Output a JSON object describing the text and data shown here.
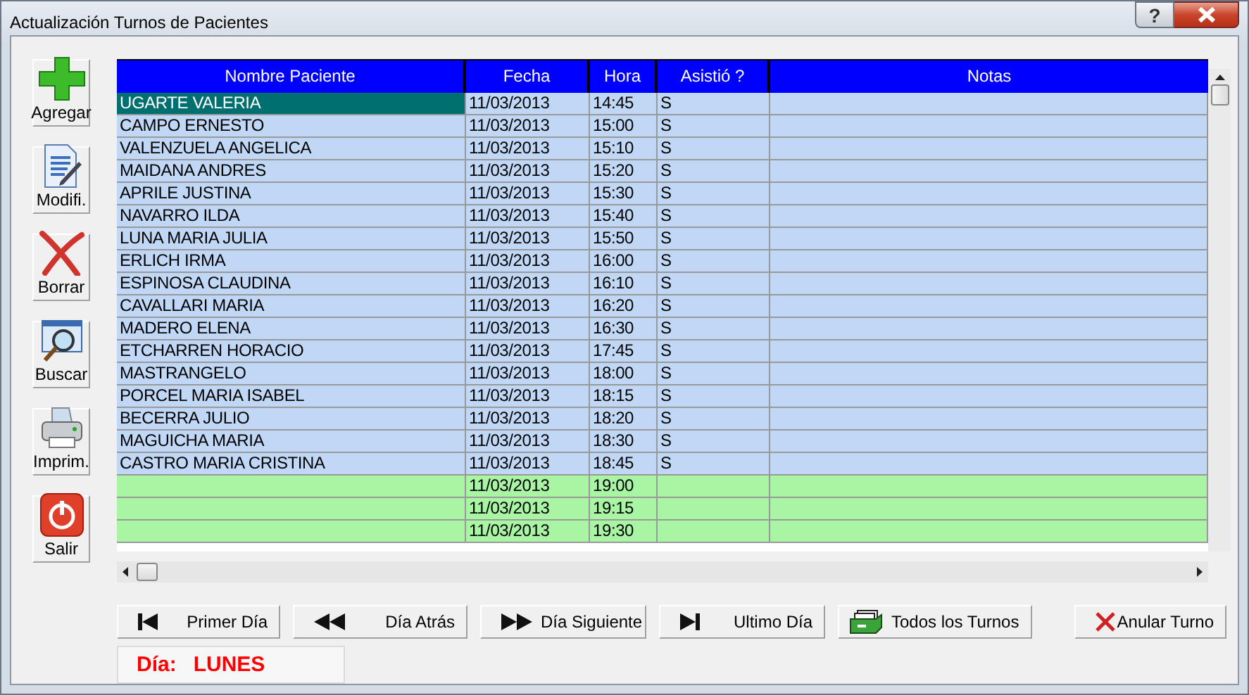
{
  "window": {
    "title": "Actualización Turnos de Pacientes",
    "help": "?"
  },
  "toolbar": [
    {
      "label": "Agregar"
    },
    {
      "label": "Modifi."
    },
    {
      "label": "Borrar"
    },
    {
      "label": "Buscar"
    },
    {
      "label": "Imprim."
    },
    {
      "label": "Salir"
    }
  ],
  "table": {
    "columns": [
      "Nombre Paciente",
      "Fecha",
      "Hora",
      "Asistió ?",
      "Notas"
    ],
    "rows": [
      {
        "kind": "booked",
        "selected": true,
        "name": "UGARTE VALERIA",
        "date": "11/03/2013",
        "time": "14:45",
        "attended": "S"
      },
      {
        "kind": "booked",
        "selected": false,
        "name": "CAMPO ERNESTO",
        "date": "11/03/2013",
        "time": "15:00",
        "attended": "S"
      },
      {
        "kind": "booked",
        "selected": false,
        "name": "VALENZUELA ANGELICA",
        "date": "11/03/2013",
        "time": "15:10",
        "attended": "S"
      },
      {
        "kind": "booked",
        "selected": false,
        "name": "MAIDANA ANDRES",
        "date": "11/03/2013",
        "time": "15:20",
        "attended": "S"
      },
      {
        "kind": "booked",
        "selected": false,
        "name": "APRILE JUSTINA",
        "date": "11/03/2013",
        "time": "15:30",
        "attended": "S"
      },
      {
        "kind": "booked",
        "selected": false,
        "name": "NAVARRO ILDA",
        "date": "11/03/2013",
        "time": "15:40",
        "attended": "S"
      },
      {
        "kind": "booked",
        "selected": false,
        "name": "LUNA MARIA JULIA",
        "date": "11/03/2013",
        "time": "15:50",
        "attended": "S"
      },
      {
        "kind": "booked",
        "selected": false,
        "name": "ERLICH IRMA",
        "date": "11/03/2013",
        "time": "16:00",
        "attended": "S"
      },
      {
        "kind": "booked",
        "selected": false,
        "name": "ESPINOSA CLAUDINA",
        "date": "11/03/2013",
        "time": "16:10",
        "attended": "S"
      },
      {
        "kind": "booked",
        "selected": false,
        "name": "CAVALLARI MARIA",
        "date": "11/03/2013",
        "time": "16:20",
        "attended": "S"
      },
      {
        "kind": "booked",
        "selected": false,
        "name": "MADERO ELENA",
        "date": "11/03/2013",
        "time": "16:30",
        "attended": "S"
      },
      {
        "kind": "booked",
        "selected": false,
        "name": "ETCHARREN HORACIO",
        "date": "11/03/2013",
        "time": "17:45",
        "attended": "S"
      },
      {
        "kind": "booked",
        "selected": false,
        "name": "MASTRANGELO",
        "date": "11/03/2013",
        "time": "18:00",
        "attended": "S"
      },
      {
        "kind": "booked",
        "selected": false,
        "name": "PORCEL MARIA ISABEL",
        "date": "11/03/2013",
        "time": "18:15",
        "attended": "S"
      },
      {
        "kind": "booked",
        "selected": false,
        "name": "BECERRA JULIO",
        "date": "11/03/2013",
        "time": "18:20",
        "attended": "S"
      },
      {
        "kind": "booked",
        "selected": false,
        "name": "MAGUICHA MARIA",
        "date": "11/03/2013",
        "time": "18:30",
        "attended": "S"
      },
      {
        "kind": "booked",
        "selected": false,
        "name": "CASTRO MARIA CRISTINA",
        "date": "11/03/2013",
        "time": "18:45",
        "attended": "S"
      },
      {
        "kind": "free",
        "selected": false,
        "date": "11/03/2013",
        "time": "19:00"
      },
      {
        "kind": "free",
        "selected": false,
        "date": "11/03/2013",
        "time": "19:15"
      },
      {
        "kind": "free",
        "selected": false,
        "date": "11/03/2013",
        "time": "19:30"
      }
    ]
  },
  "nav_buttons": [
    {
      "label": "Primer Día"
    },
    {
      "label": "Día Atrás"
    },
    {
      "label": "Día Siguiente"
    },
    {
      "label": "Ultimo Día"
    },
    {
      "label": "Todos los Turnos"
    },
    {
      "label": "Anular Turno"
    }
  ],
  "day": {
    "label": "Día:",
    "value": "LUNES"
  }
}
